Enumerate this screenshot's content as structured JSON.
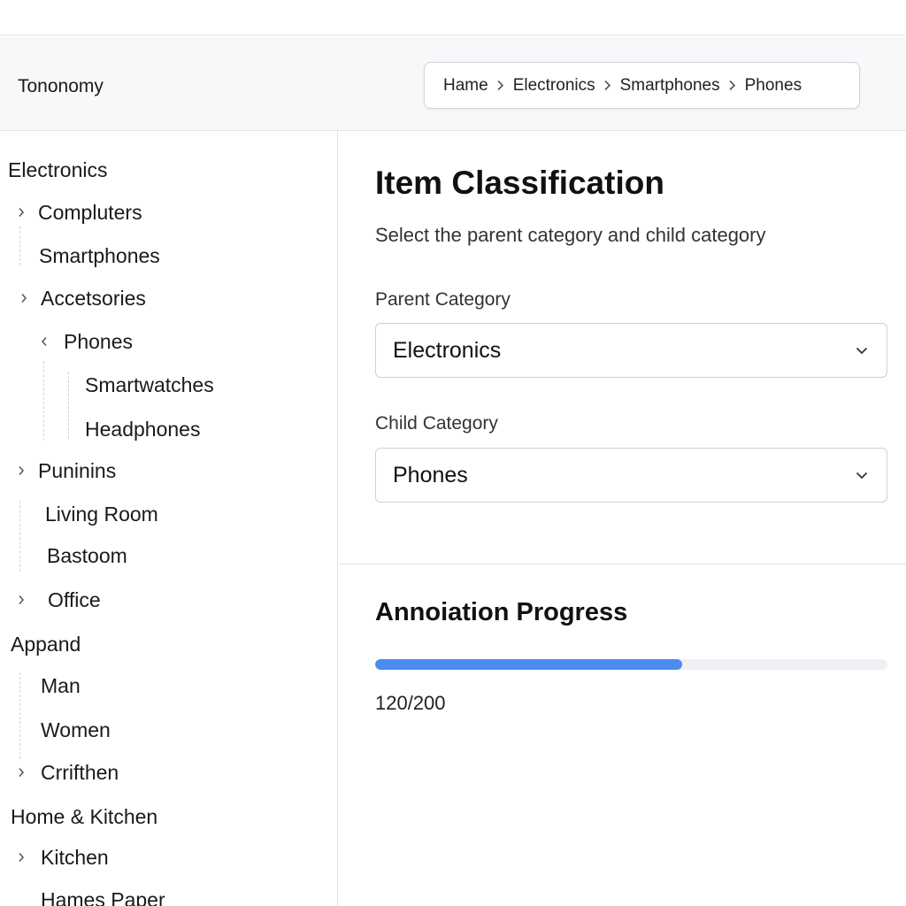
{
  "app": {
    "title": "Tononomy"
  },
  "breadcrumb": [
    "Hame",
    "Electronics",
    "Smartphones",
    "Phones"
  ],
  "sidebar": {
    "items": [
      {
        "label": "Electronics",
        "level": "category"
      },
      {
        "label": "Compluters",
        "chevron": "right"
      },
      {
        "label": "Smartphones"
      },
      {
        "label": "Accetsories",
        "chevron": "right"
      },
      {
        "label": "Phones",
        "chevron": "left"
      },
      {
        "label": "Smartwatches"
      },
      {
        "label": "Headphones"
      },
      {
        "label": "Puninins",
        "chevron": "right"
      },
      {
        "label": "Living Room"
      },
      {
        "label": "Bastoom"
      },
      {
        "label": "Office",
        "chevron": "right"
      },
      {
        "label": "Appand",
        "level": "category"
      },
      {
        "label": "Man"
      },
      {
        "label": "Women"
      },
      {
        "label": "Crrifthen",
        "chevron": "right"
      },
      {
        "label": "Home & Kitchen",
        "level": "category"
      },
      {
        "label": "Kitchen",
        "chevron": "right"
      },
      {
        "label": "Hames Paper"
      }
    ]
  },
  "classification": {
    "title": "Item Classification",
    "subtitle": "Select the parent category and child category",
    "parent_label": "Parent Category",
    "parent_value": "Electronics",
    "child_label": "Child Category",
    "child_value": "Phones"
  },
  "progress": {
    "title": "Annoiation Progress",
    "done": 120,
    "total": 200,
    "text": "120/200"
  },
  "colors": {
    "accent": "#4a8cf0",
    "track": "#eef0f3",
    "header_bg": "#f7f8fa"
  },
  "icons": {
    "breadcrumb_separator": "chevron-right-icon",
    "select_caret": "chevron-down-icon",
    "tree_expand": "chevron-right-icon",
    "tree_collapse": "chevron-left-icon"
  }
}
